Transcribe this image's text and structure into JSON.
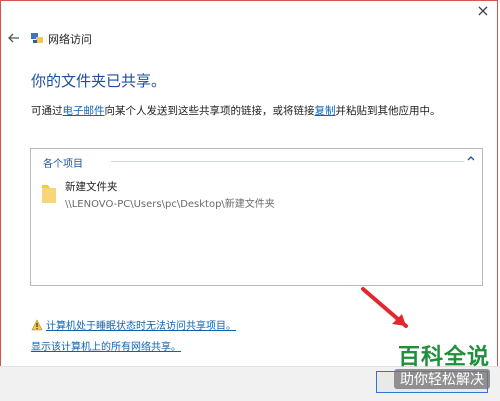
{
  "window": {
    "title": "网络访问",
    "close_glyph": "×"
  },
  "main": {
    "heading": "你的文件夹已共享。",
    "body_prefix": "可通过",
    "email_link": "电子邮件",
    "body_middle": "向某个人发送到这些共享项的链接，或将链接",
    "copy_link": "复制",
    "body_suffix": "并粘贴到其他应用中。"
  },
  "panel": {
    "header": "各个项目",
    "items": [
      {
        "name": "新建文件夹",
        "path": "\\\\LENOVO-PC\\Users\\pc\\Desktop\\新建文件夹"
      }
    ]
  },
  "links": {
    "warning": "计算机处于睡眠状态时无法访问共享项目。",
    "all_shares": "显示该计算机上的所有网络共享。"
  },
  "watermark": {
    "title": "百科全说",
    "subtitle": "助你轻松解决"
  },
  "colors": {
    "heading": "#1f4e9c",
    "link": "#0a64b6",
    "watermark_green": "#1f8f3a",
    "arrow_red": "#e0282e"
  }
}
